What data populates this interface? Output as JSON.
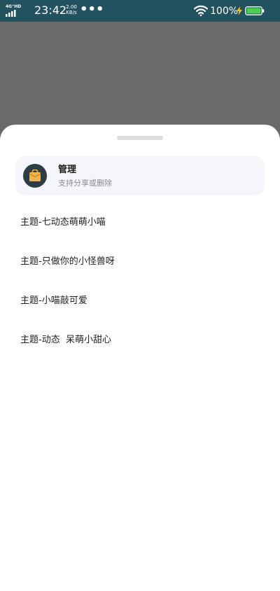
{
  "status_bar": {
    "network": "4G⁺HD",
    "time": "23:42",
    "speed_value": "2.00",
    "speed_unit": "KB/s",
    "overflow": "•••",
    "battery_percent": "100%",
    "icons": [
      "signal-icon",
      "wifi-icon",
      "charging-icon",
      "battery-icon"
    ]
  },
  "sheet": {
    "manage": {
      "title": "管理",
      "subtitle": "支持分享或删除",
      "icon": "shopping-bag-icon"
    },
    "themes": [
      {
        "label": "主题-七动态萌萌小喵"
      },
      {
        "label": "主题-只做你的小怪兽呀"
      },
      {
        "label": "主题-小喵敲可爱"
      },
      {
        "label": "主题-动态  呆萌小甜心"
      }
    ]
  },
  "colors": {
    "status_bar_bg": "#22525f",
    "scrim": "#6a6a6a",
    "card_bg": "#f4f6fc",
    "icon_circle": "#2c3d45",
    "icon_bag": "#f2b34a",
    "battery_fill": "#4ccf4a"
  }
}
